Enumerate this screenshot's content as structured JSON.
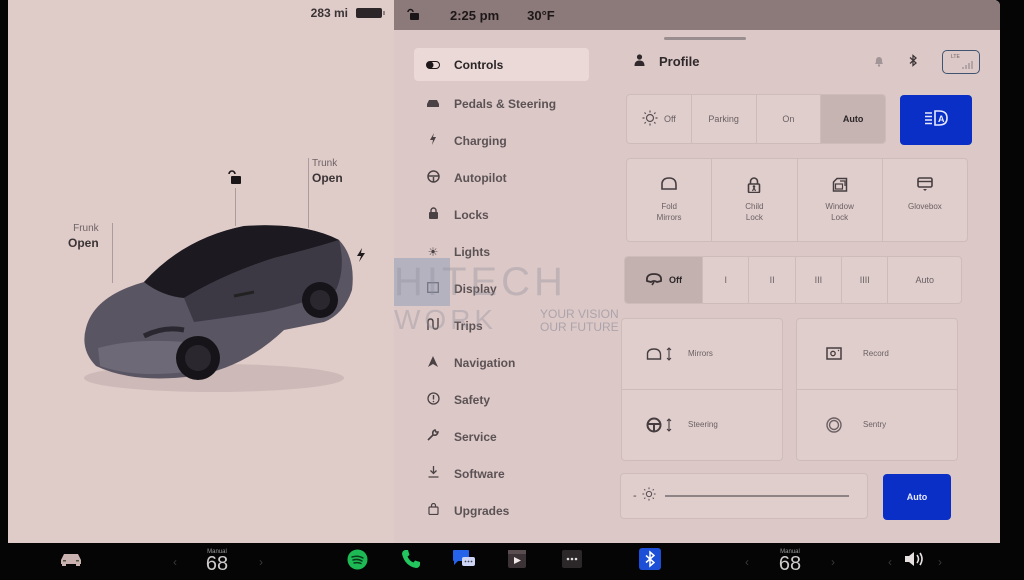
{
  "car": {
    "range": "283 mi",
    "frunk": {
      "label": "Frunk",
      "status": "Open"
    },
    "trunk": {
      "label": "Trunk",
      "status": "Open"
    },
    "lock_state": "unlocked"
  },
  "topbar": {
    "lock_icon": "unlock-icon",
    "time": "2:25 pm",
    "temperature": "30°F"
  },
  "menu": {
    "active": "Controls",
    "items": [
      {
        "label": "Controls",
        "icon": "toggle-icon"
      },
      {
        "label": "Pedals & Steering",
        "icon": "car-icon"
      },
      {
        "label": "Charging",
        "icon": "bolt-icon"
      },
      {
        "label": "Autopilot",
        "icon": "steering-wheel-icon"
      },
      {
        "label": "Locks",
        "icon": "lock-icon"
      },
      {
        "label": "Lights",
        "icon": "sun-icon"
      },
      {
        "label": "Display",
        "icon": "display-icon"
      },
      {
        "label": "Trips",
        "icon": "trips-icon"
      },
      {
        "label": "Navigation",
        "icon": "navigation-icon"
      },
      {
        "label": "Safety",
        "icon": "alert-circle-icon"
      },
      {
        "label": "Service",
        "icon": "wrench-icon"
      },
      {
        "label": "Software",
        "icon": "download-icon"
      },
      {
        "label": "Upgrades",
        "icon": "bag-icon"
      }
    ]
  },
  "profile": {
    "label": "Profile"
  },
  "status_icons": {
    "notifications": "bell-icon",
    "bluetooth": "bluetooth-icon",
    "network": "LTE"
  },
  "headlights": {
    "options": [
      "Off",
      "Parking",
      "On",
      "Auto"
    ],
    "selected": "Auto",
    "auto_high_beam": true
  },
  "quick_controls": [
    {
      "label_line1": "Fold",
      "label_line2": "Mirrors",
      "icon": "mirror-icon"
    },
    {
      "label_line1": "Child",
      "label_line2": "Lock",
      "icon": "child-lock-icon"
    },
    {
      "label_line1": "Window",
      "label_line2": "Lock",
      "icon": "window-lock-icon"
    },
    {
      "label_line1": "Glovebox",
      "label_line2": "",
      "icon": "glovebox-icon"
    }
  ],
  "wipers": {
    "options": [
      "Off",
      "I",
      "II",
      "III",
      "IIII",
      "Auto"
    ],
    "selected": "Off"
  },
  "adjust": [
    {
      "label": "Mirrors",
      "icon": "mirror-adjust-icon"
    },
    {
      "label": "Steering",
      "icon": "steering-adjust-icon"
    }
  ],
  "camera": [
    {
      "label": "Record",
      "icon": "dashcam-icon"
    },
    {
      "label": "Sentry",
      "icon": "sentry-icon"
    }
  ],
  "display_brightness": {
    "minus": "-",
    "auto_label": "Auto"
  },
  "watermark": {
    "line1": "HITECH",
    "line2": "WORK",
    "tagline1": "YOUR VISION",
    "tagline2": "OUR FUTURE"
  },
  "taskbar": {
    "driver_temp": {
      "mode": "Manual",
      "value": "68"
    },
    "passenger_temp": {
      "mode": "Manual",
      "value": "68"
    },
    "apps": [
      "car-icon",
      "spotify-icon",
      "phone-icon",
      "messages-icon",
      "media-icon",
      "more-icon",
      "bluetooth-icon"
    ],
    "volume": "volume-icon",
    "colors": {
      "spotify": "#1db954",
      "phone": "#22c55e",
      "messages": "#2563eb",
      "bluetooth": "#1d4ed8"
    }
  }
}
